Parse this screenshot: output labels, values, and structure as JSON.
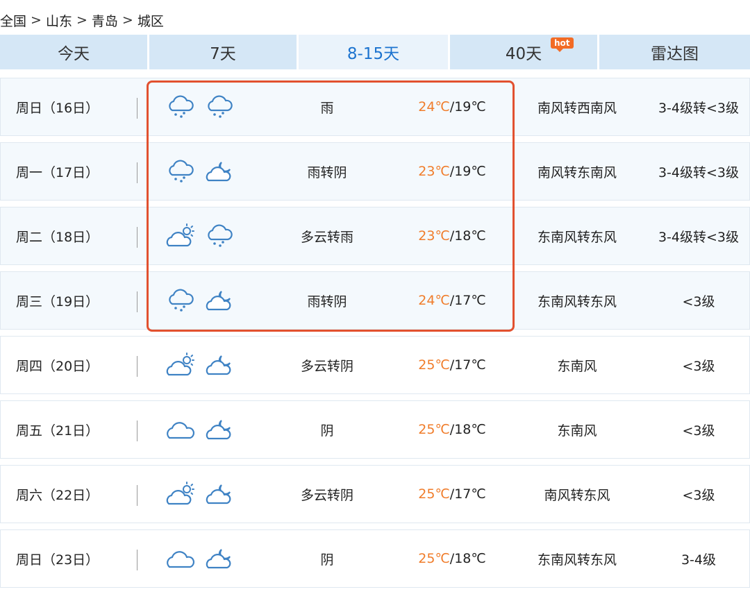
{
  "breadcrumb": [
    "全国",
    "山东",
    "青岛",
    "城区"
  ],
  "tabs": [
    {
      "label": "今天",
      "active": false
    },
    {
      "label": "7天",
      "active": false
    },
    {
      "label": "8-15天",
      "active": true
    },
    {
      "label": "40天",
      "active": false,
      "badge": "hot"
    },
    {
      "label": "雷达图",
      "active": false
    }
  ],
  "forecast": [
    {
      "date": "周日（16日）",
      "icons": [
        "rain-icon",
        "rain-icon"
      ],
      "desc": "雨",
      "high": "24℃",
      "low": "19℃",
      "wind": "南风转西南风",
      "level": "3-4级转<3级"
    },
    {
      "date": "周一（17日）",
      "icons": [
        "rain-icon",
        "overcast-night-icon"
      ],
      "desc": "雨转阴",
      "high": "23℃",
      "low": "19℃",
      "wind": "南风转东南风",
      "level": "3-4级转<3级"
    },
    {
      "date": "周二（18日）",
      "icons": [
        "cloudy-sun-icon",
        "rain-icon"
      ],
      "desc": "多云转雨",
      "high": "23℃",
      "low": "18℃",
      "wind": "东南风转东风",
      "level": "3-4级转<3级"
    },
    {
      "date": "周三（19日）",
      "icons": [
        "rain-icon",
        "overcast-night-icon"
      ],
      "desc": "雨转阴",
      "high": "24℃",
      "low": "17℃",
      "wind": "东南风转东风",
      "level": "<3级"
    },
    {
      "date": "周四（20日）",
      "icons": [
        "cloudy-sun-icon",
        "overcast-night-icon"
      ],
      "desc": "多云转阴",
      "high": "25℃",
      "low": "17℃",
      "wind": "东南风",
      "level": "<3级"
    },
    {
      "date": "周五（21日）",
      "icons": [
        "cloud-icon",
        "overcast-night-icon"
      ],
      "desc": "阴",
      "high": "25℃",
      "low": "18℃",
      "wind": "东南风",
      "level": "<3级"
    },
    {
      "date": "周六（22日）",
      "icons": [
        "cloudy-sun-icon",
        "overcast-night-icon"
      ],
      "desc": "多云转阴",
      "high": "25℃",
      "low": "17℃",
      "wind": "南风转东风",
      "level": "<3级"
    },
    {
      "date": "周日（23日）",
      "icons": [
        "cloud-icon",
        "overcast-night-icon"
      ],
      "desc": "阴",
      "high": "25℃",
      "low": "18℃",
      "wind": "东南风转东风",
      "level": "3-4级"
    }
  ],
  "colors": {
    "accent": "#1c73cf",
    "high_temp": "#f07c2a",
    "highlight_border": "#e2512f",
    "tab_bg": "#d5e7f6",
    "row_bg": "#f4f9fd",
    "icon_stroke": "#3e82c4"
  }
}
